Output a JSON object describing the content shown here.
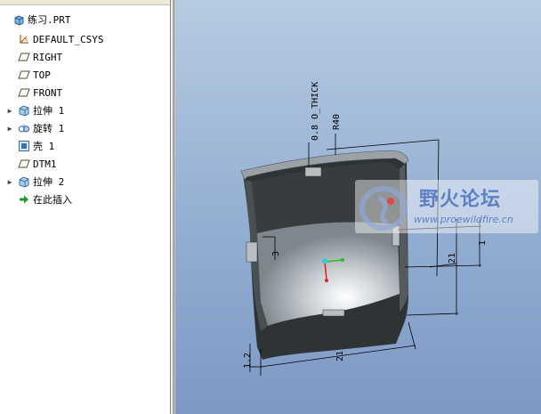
{
  "model_tree": {
    "items": [
      {
        "label": "练习.PRT",
        "icon": "part-icon",
        "expandable": false
      },
      {
        "label": "DEFAULT_CSYS",
        "icon": "coordinate-system-icon",
        "expandable": false
      },
      {
        "label": "RIGHT",
        "icon": "datum-plane-icon",
        "expandable": false
      },
      {
        "label": "TOP",
        "icon": "datum-plane-icon",
        "expandable": false
      },
      {
        "label": "FRONT",
        "icon": "datum-plane-icon",
        "expandable": false
      },
      {
        "label": "拉伸 1",
        "icon": "extrude-icon",
        "expandable": true
      },
      {
        "label": "旋转 1",
        "icon": "revolve-icon",
        "expandable": true
      },
      {
        "label": "壳 1",
        "icon": "shell-icon",
        "expandable": false
      },
      {
        "label": "DTM1",
        "icon": "datum-plane-icon",
        "expandable": false
      },
      {
        "label": "拉伸 2",
        "icon": "extrude-icon",
        "expandable": true
      },
      {
        "label": "在此插入",
        "icon": "insert-here-arrow-icon",
        "expandable": false
      }
    ]
  },
  "viewport": {
    "dimensions": {
      "thick": "0.8 O_THICK",
      "r40": "R40",
      "d3": "3",
      "d1": "1",
      "d21_right": "21",
      "d21_bottom": "21",
      "d12": "1.2"
    }
  },
  "watermark": {
    "title": "野火论坛",
    "url": "www.proewildfire.cn"
  },
  "colors": {
    "viewport_top": "#b7cbe2",
    "viewport_bottom": "#7d99c4",
    "model_dark": "#2e3336",
    "model_rim": "#9aa2a8",
    "watermark_text": "#5f7fc4"
  }
}
